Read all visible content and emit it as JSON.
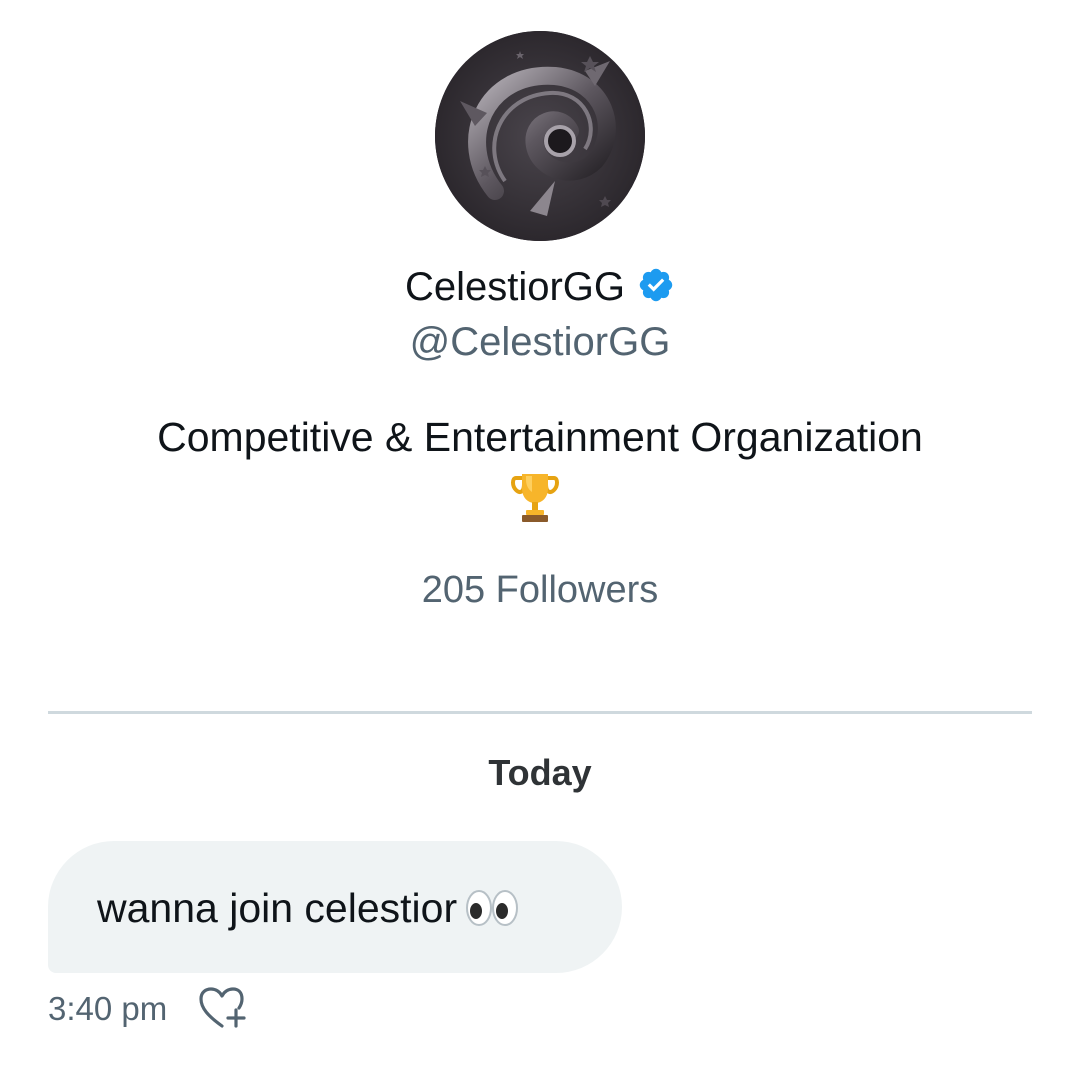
{
  "profile": {
    "display_name": "CelestiorGG",
    "handle": "@CelestiorGG",
    "bio": "Competitive & Entertainment Organization",
    "followers": "205 Followers",
    "verified": true,
    "verified_color": "#1d9bf0",
    "avatar_icon": "celestior-logo"
  },
  "conversation": {
    "date_separator": "Today",
    "messages": [
      {
        "text": "wanna join celestior",
        "emoji_icon": "eyes-emoji",
        "time": "3:40 pm",
        "reaction_icon": "add-reaction-heart-icon"
      }
    ]
  },
  "colors": {
    "secondary_text": "#536471",
    "bubble_bg": "#eff3f4",
    "divider": "#cfd9de"
  }
}
